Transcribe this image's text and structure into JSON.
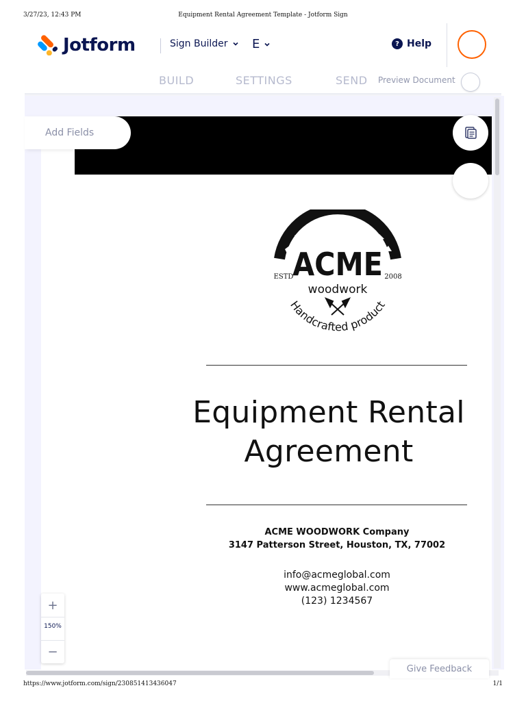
{
  "print": {
    "datetime": "3/27/23, 12:43 PM",
    "title": "Equipment Rental Agreement Template - Jotform Sign",
    "url": "https://www.jotform.com/sign/230851413436047",
    "page": "1/1"
  },
  "header": {
    "brand": "Jotform",
    "menu_label": "Sign Builder",
    "user_menu_label": "E",
    "help_label": "Help",
    "help_glyph": "?"
  },
  "tabs": {
    "build": "BUILD",
    "settings": "SETTINGS",
    "send": "SEND",
    "preview_label": "Preview Document"
  },
  "canvas": {
    "add_fields_label": "Add Fields",
    "zoom_in": "+",
    "zoom_level": "150%",
    "zoom_out": "−",
    "feedback_label": "Give Feedback"
  },
  "document": {
    "logo": {
      "main": "ACME",
      "sub": "woodwork",
      "left_text": "ESTD",
      "right_text": "2008",
      "arc_text": "Handcrafted product"
    },
    "title_line1": "Equipment Rental",
    "title_line2": "Agreement",
    "company_name": "ACME WOODWORK Company",
    "company_address": "3147 Patterson Street, Houston, TX, 77002",
    "email": "info@acmeglobal.com",
    "website": "www.acmeglobal.com",
    "phone": "(123) 1234567"
  },
  "colors": {
    "brand_navy": "#0a1551",
    "brand_orange": "#ff6100",
    "tab_inactive": "#b6bace",
    "canvas_bg": "#f3f3fe"
  },
  "icons": {
    "logo": "jotform-logo-icon",
    "menu_chevron": "chevron-down-icon",
    "help": "question-circle-icon",
    "side_1": "document-list-icon",
    "side_2": "circle-button-icon"
  }
}
